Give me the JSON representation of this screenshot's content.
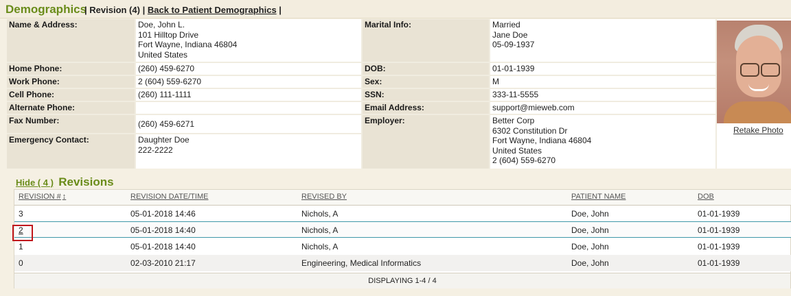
{
  "header": {
    "title": "Demographics",
    "revision_label": "Revision (4)",
    "back_link": "Back to Patient Demographics",
    "sep1": "|",
    "sep2": "|"
  },
  "demographics": {
    "name_address_label": "Name & Address:",
    "name_address_value": "Doe, John L.\n101 Hilltop Drive\nFort Wayne, Indiana 46804\nUnited States",
    "home_phone_label": "Home Phone:",
    "home_phone_value": "(260) 459-6270",
    "work_phone_label": "Work Phone:",
    "work_phone_value": "2 (604) 559-6270",
    "cell_phone_label": "Cell Phone:",
    "cell_phone_value": "(260) 111-1111",
    "alt_phone_label": "Alternate Phone:",
    "alt_phone_value": "",
    "fax_label": "Fax Number:",
    "fax_value": "(260) 459-6271",
    "emergency_label": "Emergency Contact:",
    "emergency_value": "Daughter Doe\n222-2222",
    "marital_label": "Marital Info:",
    "marital_value": "Married\nJane Doe\n05-09-1937",
    "dob_label": "DOB:",
    "dob_value": "01-01-1939",
    "sex_label": "Sex:",
    "sex_value": "M",
    "ssn_label": "SSN:",
    "ssn_value": "333-11-5555",
    "email_label": "Email Address:",
    "email_value": "support@mieweb.com",
    "employer_label": "Employer:",
    "employer_value": "Better Corp\n6302 Constitution Dr\nFort Wayne, Indiana 46804\nUnited States\n2 (604) 559-6270"
  },
  "photo": {
    "retake_label": "Retake Photo"
  },
  "revisions": {
    "hide_label": "Hide ( 4 )",
    "title": "Revisions",
    "columns": [
      "REVISION #",
      "REVISION DATE/TIME",
      "REVISED BY",
      "PATIENT NAME",
      "DOB"
    ],
    "sort_icon": "↕",
    "rows": [
      {
        "rev": "3",
        "date": "05-01-2018 14:46",
        "by": "Nichols, A",
        "patient": "Doe, John",
        "dob": "01-01-1939"
      },
      {
        "rev": "2",
        "date": "05-01-2018 14:40",
        "by": "Nichols, A",
        "patient": "Doe, John",
        "dob": "01-01-1939"
      },
      {
        "rev": "1",
        "date": "05-01-2018 14:40",
        "by": "Nichols, A",
        "patient": "Doe, John",
        "dob": "01-01-1939"
      },
      {
        "rev": "0",
        "date": "02-03-2010 21:17",
        "by": "Engineering, Medical Informatics",
        "patient": "Doe, John",
        "dob": "01-01-1939"
      }
    ],
    "footer": "DISPLAYING 1-4 / 4"
  },
  "colors": {
    "accent_green": "#6a8c1a",
    "label_bg": "#e9e3d4",
    "highlight_red": "#c0161b",
    "selected_row_border": "#3f97a8"
  }
}
